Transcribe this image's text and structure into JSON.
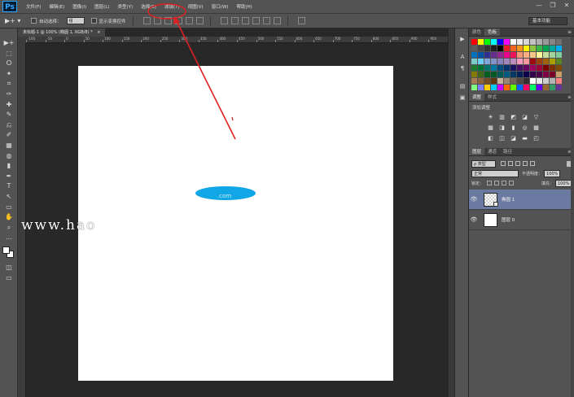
{
  "app": {
    "logo": "Ps"
  },
  "menu": [
    "文件(F)",
    "编辑(E)",
    "图像(I)",
    "图层(L)",
    "类型(Y)",
    "选择(S)",
    "滤镜(T)",
    "视图(V)",
    "窗口(W)",
    "帮助(H)"
  ],
  "window_controls": {
    "minimize": "—",
    "restore": "❐",
    "close": "✕"
  },
  "options_bar": {
    "tool_glyph": "▶+ ▾",
    "auto_select_label": "自动选择：",
    "auto_select_value": "组",
    "show_transform_label": "显示变换控件",
    "workspace": "基本功能"
  },
  "document": {
    "tab_title": "未标题-1 @ 100% (椭圆 1, RGB/8) *",
    "tab_close": "×",
    "ruler_ticks": [
      "-100",
      "-50",
      "0",
      "50",
      "100",
      "150",
      "200",
      "250",
      "300",
      "350",
      "400",
      "450",
      "500",
      "550",
      "600",
      "650",
      "700",
      "750",
      "800",
      "850",
      "900",
      "950"
    ],
    "ellipse_color": "#11a6e6",
    "ellipse_overlay_text": ".com"
  },
  "watermark": "www.hao",
  "annotation": {
    "color": "#e02020",
    "target": "滤镜(T)"
  },
  "tools": [
    "▶+",
    "⬚",
    "ⵔ",
    "✦",
    "⌗",
    "✑",
    "✚",
    "✎",
    "⎌",
    "✐",
    "▦",
    "◍",
    "▮",
    "✒",
    "T",
    "↖",
    "▭",
    "✋",
    "⌕",
    "…"
  ],
  "side_icons": [
    "▶",
    "A",
    "¶",
    "▤",
    "▣"
  ],
  "swatches": {
    "tabs": [
      "颜色",
      "色板"
    ],
    "active": "色板",
    "colors": [
      "#ff0000",
      "#ffff00",
      "#00ff00",
      "#00ffff",
      "#0000ff",
      "#ff00ff",
      "#ffffff",
      "#ebebeb",
      "#d6d6d6",
      "#c2c2c2",
      "#adadad",
      "#999999",
      "#858585",
      "#707070",
      "#5c5c5c",
      "#474747",
      "#333333",
      "#1f1f1f",
      "#000000",
      "#ed1c24",
      "#f26522",
      "#f7941d",
      "#fff200",
      "#8dc63f",
      "#39b54a",
      "#00a651",
      "#00a99d",
      "#00aeef",
      "#0072bc",
      "#0054a6",
      "#2e3192",
      "#662d91",
      "#92278f",
      "#ec008c",
      "#ed145b",
      "#f69679",
      "#f9ad81",
      "#fdc689",
      "#fff799",
      "#c4df9b",
      "#a3d39c",
      "#82ca9c",
      "#7accc8",
      "#6dcff6",
      "#7da7d9",
      "#8393ca",
      "#8781bd",
      "#a186be",
      "#bd8cbf",
      "#f49ac1",
      "#f5989d",
      "#9e0b0f",
      "#a0410d",
      "#a36209",
      "#aba000",
      "#598527",
      "#1a7b30",
      "#007236",
      "#00746b",
      "#0076a3",
      "#004a80",
      "#003471",
      "#1b1464",
      "#440e62",
      "#630460",
      "#9e005d",
      "#9e0039",
      "#790000",
      "#7b2e00",
      "#7d4900",
      "#827b00",
      "#406618",
      "#005e20",
      "#005826",
      "#005952",
      "#005b7f",
      "#003663",
      "#002157",
      "#0d004c",
      "#32004b",
      "#4b0049",
      "#7b0046",
      "#7a0026",
      "#c69c6d",
      "#a67c52",
      "#8c6239",
      "#754c24",
      "#603913",
      "#c7b299",
      "#998675",
      "#736357",
      "#534741",
      "#362f2d",
      "#ffffff",
      "#e6e6e6",
      "#cccccc",
      "#b3b3b3",
      "#ff8080",
      "#80ff80",
      "#8080ff",
      "#ffcc00",
      "#00ccff",
      "#cc00ff",
      "#ff6600",
      "#66ff00",
      "#0066ff",
      "#ff0066",
      "#00ff66",
      "#6600ff",
      "#996633",
      "#339966",
      "#663399"
    ]
  },
  "adjustments": {
    "tabs": [
      "调整",
      "样式"
    ],
    "active": "调整",
    "title": "添加调整",
    "rows": [
      [
        "☀",
        "▥",
        "◩",
        "◪",
        "▽"
      ],
      [
        "▦",
        "◨",
        "▮",
        "◎",
        "▩"
      ],
      [
        "◧",
        "◫",
        "◪",
        "▬",
        "◰"
      ]
    ]
  },
  "layers_panel": {
    "tabs": [
      "图层",
      "通道",
      "路径"
    ],
    "active": "图层",
    "filter_kind": "ρ 类型",
    "blend_mode": "正常",
    "opacity_label": "不透明度：",
    "opacity": "100%",
    "lock_label": "锁定：",
    "fill_label": "填充：",
    "fill": "100%",
    "layers": [
      {
        "name": "椭圆 1",
        "selected": true,
        "eye": "👁"
      },
      {
        "name": "图层 0",
        "selected": false,
        "eye": "👁"
      }
    ]
  }
}
